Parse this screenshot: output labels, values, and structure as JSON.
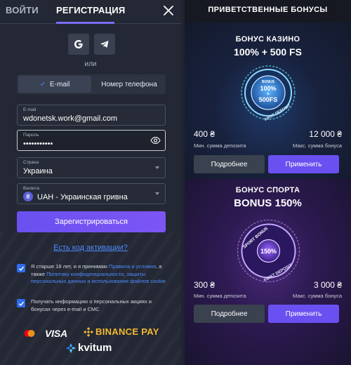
{
  "auth": {
    "tab_login": "ВОЙТИ",
    "tab_register": "РЕГИСТРАЦИЯ",
    "social": [
      "google-icon",
      "telegram-icon"
    ],
    "or_text": "или",
    "method_email": "E-mail",
    "method_phone": "Номер телефона",
    "email_label": "E-mail",
    "email_value": "wdonetsk.work@gmail.com",
    "password_label": "Пароль",
    "password_value": "•••••••••••",
    "country_label": "Страна",
    "country_value": "Украина",
    "currency_label": "Валюта",
    "currency_symbol": "₴",
    "currency_value": "UAH - Украинская гривна",
    "register_button": "Зарегистрироваться",
    "promo_link": "Есть код активации?",
    "consent1_text": "Я старше 18 лет, и я принимаю ",
    "consent1_link1": "Правила и условия",
    "consent1_mid": ", а также ",
    "consent1_link2": "Политику конфиденциальности, защиты персональных данных и использования файлов cookie",
    "consent2_text": "Получать информацию о персональных акциях и бонусах через e-mail и СМС",
    "payments": {
      "visa": "VISA",
      "binance": "BINANCE PAY",
      "kvitum": "kvitum"
    },
    "colors": {
      "accent": "#6a50f0",
      "link": "#4f8bff",
      "panel": "#232834"
    }
  },
  "bonuses": {
    "title": "ПРИВЕТСТВЕННЫЕ БОНУСЫ",
    "casino": {
      "title": "БОНУС КАЗИНО",
      "headline": "100% + 500 FS",
      "medal_top": "BONUS",
      "medal_line1": "100%",
      "medal_line2": "+",
      "medal_line3": "500FS",
      "medal_bottom": "FIRST DEPOSIT",
      "min_amount": "400 ₴",
      "min_label": "Мин. сумма депозита",
      "max_amount": "12 000 ₴",
      "max_label": "Макс. сумма бонуса",
      "more_button": "Подробнее",
      "apply_button": "Применить"
    },
    "sport": {
      "title": "БОНУС СПОРТА",
      "headline": "BONUS 150%",
      "medal_top": "SPORT BONUS",
      "medal_center": "150%",
      "medal_bottom": "FIRST DEPOSIT",
      "min_amount": "300 ₴",
      "min_label": "Мин. сумма депозита",
      "max_amount": "3 000 ₴",
      "max_label": "Макс. сумма бонуса",
      "more_button": "Подробнее",
      "apply_button": "Применить"
    }
  }
}
